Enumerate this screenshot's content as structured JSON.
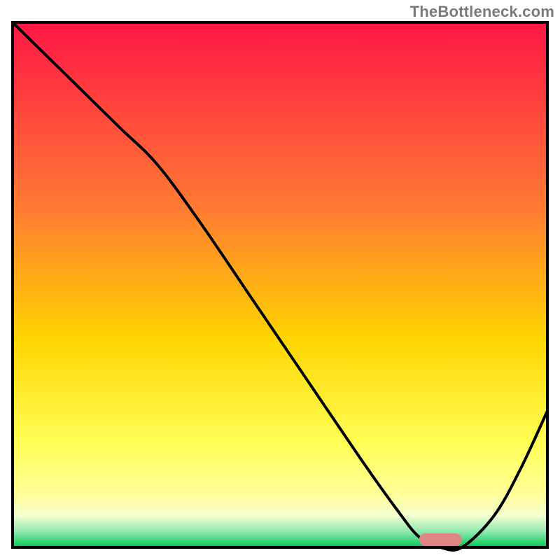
{
  "attribution": "TheBottleneck.com",
  "colors": {
    "gradient_top": "#ff1745",
    "gradient_upper_mid": "#ff7a33",
    "gradient_mid": "#ffd400",
    "gradient_low": "#ffff9a",
    "gradient_base1": "#f3ffcf",
    "gradient_base2": "#8fe8b0",
    "gradient_bottom": "#00c853",
    "curve": "#000000",
    "marker": "#e08585",
    "border": "#000000"
  },
  "chart_data": {
    "type": "line",
    "title": "",
    "xlabel": "",
    "ylabel": "",
    "xlim": [
      0,
      100
    ],
    "ylim": [
      0,
      100
    ],
    "x": [
      0,
      10,
      20,
      27,
      35,
      45,
      55,
      65,
      72,
      76,
      80,
      84,
      90,
      95,
      100
    ],
    "values": [
      100,
      90,
      80,
      73,
      62,
      47,
      32,
      17,
      7,
      2,
      0,
      0,
      6,
      15,
      26
    ],
    "optimum_range_x": [
      76,
      84
    ],
    "annotations": []
  }
}
